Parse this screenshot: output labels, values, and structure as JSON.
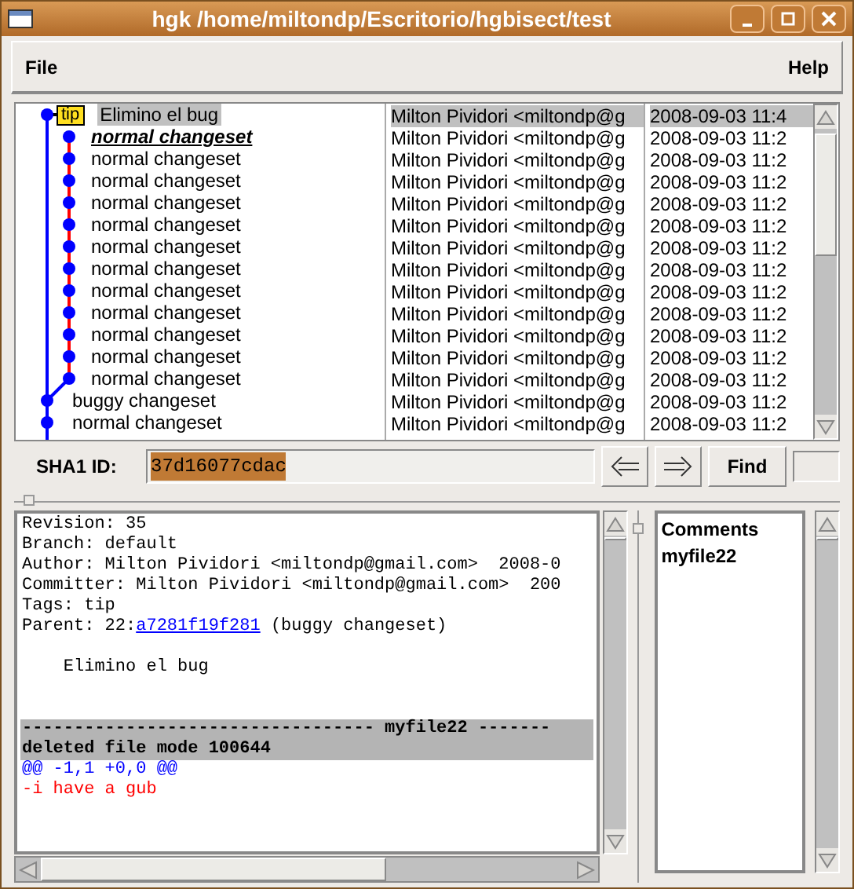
{
  "window": {
    "title": "hgk /home/miltondp/Escritorio/hgbisect/test"
  },
  "menu": [
    "File",
    "Help"
  ],
  "commits": [
    {
      "summary": "Elimino el bug",
      "tag": "tip",
      "author": "Milton Pividori <miltondp@g",
      "date": "2008-09-03 11:4",
      "selected": true,
      "emphasized": false
    },
    {
      "summary": "normal changeset",
      "author": "Milton Pividori <miltondp@g",
      "date": "2008-09-03 11:2",
      "selected": false,
      "emphasized": true
    },
    {
      "summary": "normal changeset",
      "author": "Milton Pividori <miltondp@g",
      "date": "2008-09-03 11:2",
      "selected": false,
      "emphasized": false
    },
    {
      "summary": "normal changeset",
      "author": "Milton Pividori <miltondp@g",
      "date": "2008-09-03 11:2",
      "selected": false,
      "emphasized": false
    },
    {
      "summary": "normal changeset",
      "author": "Milton Pividori <miltondp@g",
      "date": "2008-09-03 11:2",
      "selected": false,
      "emphasized": false
    },
    {
      "summary": "normal changeset",
      "author": "Milton Pividori <miltondp@g",
      "date": "2008-09-03 11:2",
      "selected": false,
      "emphasized": false
    },
    {
      "summary": "normal changeset",
      "author": "Milton Pividori <miltondp@g",
      "date": "2008-09-03 11:2",
      "selected": false,
      "emphasized": false
    },
    {
      "summary": "normal changeset",
      "author": "Milton Pividori <miltondp@g",
      "date": "2008-09-03 11:2",
      "selected": false,
      "emphasized": false
    },
    {
      "summary": "normal changeset",
      "author": "Milton Pividori <miltondp@g",
      "date": "2008-09-03 11:2",
      "selected": false,
      "emphasized": false
    },
    {
      "summary": "normal changeset",
      "author": "Milton Pividori <miltondp@g",
      "date": "2008-09-03 11:2",
      "selected": false,
      "emphasized": false
    },
    {
      "summary": "normal changeset",
      "author": "Milton Pividori <miltondp@g",
      "date": "2008-09-03 11:2",
      "selected": false,
      "emphasized": false
    },
    {
      "summary": "normal changeset",
      "author": "Milton Pividori <miltondp@g",
      "date": "2008-09-03 11:2",
      "selected": false,
      "emphasized": false
    },
    {
      "summary": "normal changeset",
      "author": "Milton Pividori <miltondp@g",
      "date": "2008-09-03 11:2",
      "selected": false,
      "emphasized": false
    },
    {
      "summary": "buggy changeset",
      "author": "Milton Pividori <miltondp@g",
      "date": "2008-09-03 11:2",
      "selected": false,
      "emphasized": false
    },
    {
      "summary": "normal changeset",
      "author": "Milton Pividori <miltondp@g",
      "date": "2008-09-03 11:2",
      "selected": false,
      "emphasized": false
    }
  ],
  "sha1": {
    "label": "SHA1 ID:",
    "value": "37d16077cdac"
  },
  "find_button": "Find",
  "details": [
    {
      "kind": "plain",
      "text": "Revision: 35"
    },
    {
      "kind": "plain",
      "text": "Branch: default"
    },
    {
      "kind": "plain",
      "text": "Author: Milton Pividori <miltondp@gmail.com>  2008-0"
    },
    {
      "kind": "plain",
      "text": "Committer: Milton Pividori <miltondp@gmail.com>  200"
    },
    {
      "kind": "plain",
      "text": "Tags: tip"
    },
    {
      "kind": "parent",
      "text": "Parent: 22:",
      "link": "a7281f19f281",
      "suffix": " (buggy changeset)"
    },
    {
      "kind": "blank"
    },
    {
      "kind": "plain",
      "text": "    Elimino el bug"
    },
    {
      "kind": "blank"
    },
    {
      "kind": "blank"
    },
    {
      "kind": "filehead",
      "text": "---------------------------------- myfile22 -------"
    },
    {
      "kind": "filehead",
      "text": "deleted file mode 100644"
    },
    {
      "kind": "hunk",
      "text": "@@ -1,1 +0,0 @@"
    },
    {
      "kind": "removed",
      "text": "-i have a gub"
    }
  ],
  "files": [
    "Comments",
    "myfile22"
  ]
}
